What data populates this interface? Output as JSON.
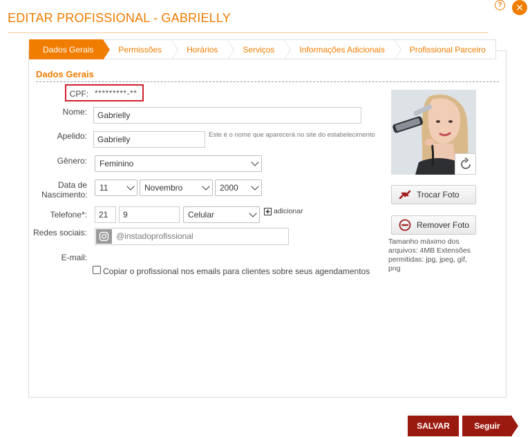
{
  "header": {
    "title": "EDITAR PROFISSIONAL - GABRIELLY",
    "help_icon": "help-icon",
    "close_icon": "close-icon"
  },
  "tabs": [
    {
      "label": "Dados Gerais",
      "active": true
    },
    {
      "label": "Permissões",
      "active": false
    },
    {
      "label": "Horários",
      "active": false
    },
    {
      "label": "Serviços",
      "active": false
    },
    {
      "label": "Informações Adicionais",
      "active": false
    },
    {
      "label": "Profissional Parceiro",
      "active": false
    }
  ],
  "section": {
    "title": "Dados Gerais"
  },
  "form": {
    "cpf": {
      "label": "CPF:",
      "value": "*********-**"
    },
    "nome": {
      "label": "Nome:",
      "value": "Gabrielly"
    },
    "apelido": {
      "label": "Apelido:",
      "value": "Gabrielly",
      "hint": "Este é o nome que aparecerá no site do estabelecimento"
    },
    "genero": {
      "label": "Gênero:",
      "value": "Feminino"
    },
    "nascimento": {
      "label_line1": "Data de",
      "label_line2": "Nascimento:",
      "day": "11",
      "month": "Novembro",
      "year": "2000"
    },
    "telefone": {
      "label": "Telefone*:",
      "ddd": "21",
      "number": "9",
      "type": "Celular",
      "add_label": "adicionar"
    },
    "redes": {
      "label": "Redes sociais:",
      "placeholder": "@instadoprofissional",
      "icon": "instagram-icon"
    },
    "email": {
      "label": "E-mail:"
    },
    "copy": {
      "label": "Copiar o profissional nos emails para clientes sobre seus agendamentos",
      "checked": false
    }
  },
  "photo": {
    "change_label": "Trocar Foto",
    "remove_label": "Remover Foto",
    "size_note": "Tamanho máximo dos arquivos: 4MB Extensões permitidas: jpg, jpeg, gif, png"
  },
  "footer": {
    "save_label": "SALVAR",
    "next_label": "Seguir"
  },
  "colors": {
    "accent": "#f07c00",
    "dark_red": "#9b1a10",
    "highlight": "#d21f2a"
  }
}
